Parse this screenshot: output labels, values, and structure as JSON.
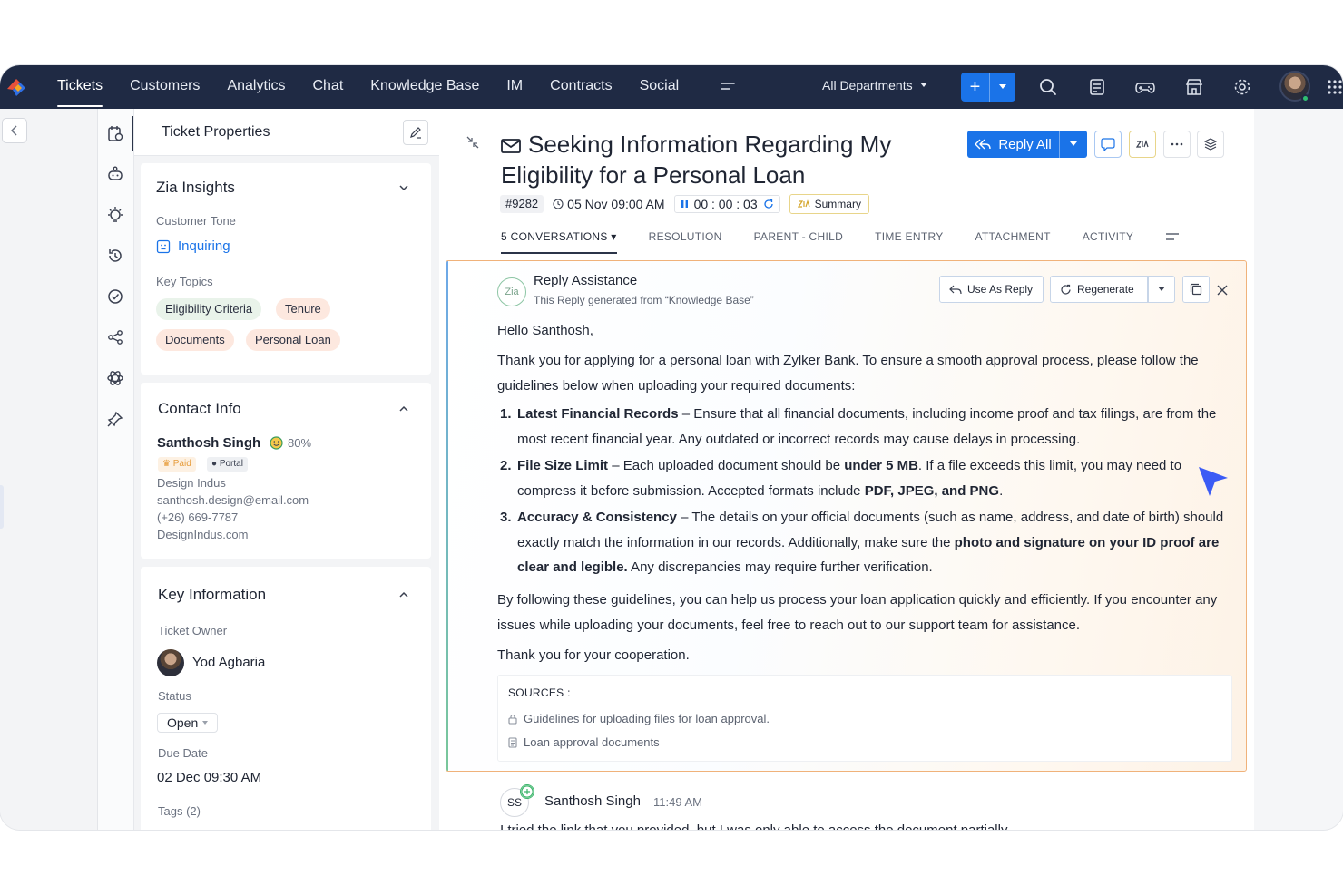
{
  "nav": {
    "tabs": [
      "Tickets",
      "Customers",
      "Analytics",
      "Chat",
      "Knowledge Base",
      "IM",
      "Contracts",
      "Social"
    ],
    "department": "All Departments",
    "add_label": "+"
  },
  "props": {
    "title": "Ticket Properties",
    "zia": {
      "title": "Zia Insights",
      "tone_label": "Customer Tone",
      "tone_value": "Inquiring",
      "topics_label": "Key Topics",
      "topics": [
        "Eligibility Criteria",
        "Tenure",
        "Documents",
        "Personal Loan"
      ]
    },
    "contact": {
      "title": "Contact Info",
      "name": "Santhosh Singh",
      "happiness": "80%",
      "badge_paid": "Paid",
      "badge_portal": "Portal",
      "company": "Design Indus",
      "email": "santhosh.design@email.com",
      "phone": "(+26) 669-7787",
      "website": "DesignIndus.com"
    },
    "key_info": {
      "title": "Key Information",
      "owner_label": "Ticket Owner",
      "owner": "Yod Agbaria",
      "status_label": "Status",
      "status": "Open",
      "due_label": "Due Date",
      "due": "02 Dec 09:30 AM",
      "tags_label": "Tags (2)"
    }
  },
  "ticket": {
    "title": "Seeking Information Regarding My Eligibility for a Personal Loan",
    "id": "#9282",
    "date": "05 Nov 09:00 AM",
    "timer": "00 : 00 : 03",
    "summary": "Summary",
    "reply_all": "Reply All",
    "tabs": [
      "5 CONVERSATIONS",
      "RESOLUTION",
      "PARENT - CHILD",
      "TIME ENTRY",
      "ATTACHMENT",
      "ACTIVITY"
    ]
  },
  "assist": {
    "title": "Reply Assistance",
    "subtitle": "This Reply generated from “Knowledge Base”",
    "zia_mark": "Zia",
    "use_as_reply": "Use As Reply",
    "regenerate": "Regenerate",
    "greeting": "Hello Santhosh,",
    "intro": "Thank you for applying for a personal loan with Zylker Bank. To ensure a smooth approval process, please follow the guidelines below when uploading your required documents:",
    "items": [
      {
        "num": "1.",
        "head": "Latest Financial Records",
        "text": " – Ensure that all financial documents, including income proof and tax filings, are from the most recent financial year. Any outdated or incorrect records may cause delays in processing."
      },
      {
        "num": "2.",
        "head": "File Size Limit",
        "text_a": " – Each uploaded document should be ",
        "bold_a": "under 5 MB",
        "text_b": ". If a file exceeds this limit, you may need to compress it before submission. Accepted formats include ",
        "bold_b": "PDF, JPEG, and PNG",
        "text_c": "."
      },
      {
        "num": "3.",
        "head": "Accuracy & Consistency",
        "text_a": " – The details on your official documents (such as name, address, and date of birth) should exactly match the information in our records. Additionally, make sure the ",
        "bold_a": "photo and signature on your ID proof are clear and legible.",
        "text_b": " Any discrepancies may require further verification."
      }
    ],
    "closing": "By following these guidelines, you can help us process your loan application quickly and efficiently. If you encounter any issues while uploading your documents, feel free to reach out to our support team for assistance.",
    "thanks": "Thank you for your cooperation.",
    "sources_title": "SOURCES :",
    "sources": [
      "Guidelines for uploading files for loan approval.",
      "Loan approval documents"
    ]
  },
  "next_conv": {
    "initials": "SS",
    "name": "Santhosh Singh",
    "time": "11:49 AM",
    "preview": "I tried the link that you provided, but I was only able to access the document partially..."
  },
  "colors": {
    "nav_bg": "#1f2a44",
    "accent": "#1a73e8",
    "assist_border": "#f0b27a"
  }
}
